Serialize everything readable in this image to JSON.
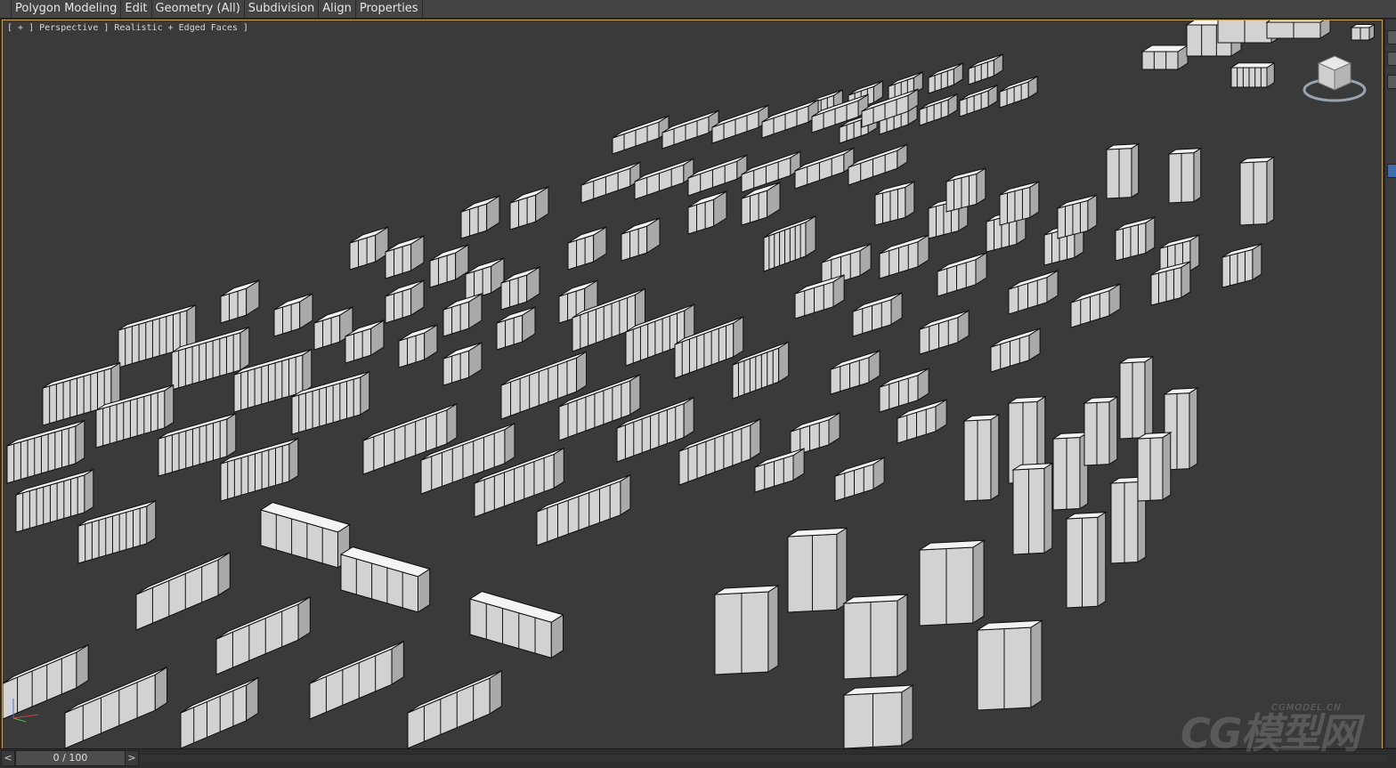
{
  "ribbon": {
    "tabs": [
      {
        "label": "Polygon Modeling"
      },
      {
        "label": "Edit"
      },
      {
        "label": "Geometry (All)"
      },
      {
        "label": "Subdivision"
      },
      {
        "label": "Align"
      },
      {
        "label": "Properties"
      }
    ]
  },
  "viewport": {
    "label": "[ + ] Perspective ] Realistic + Edged Faces ]"
  },
  "timeline": {
    "prev_label": "<",
    "next_label": ">",
    "frame_label": "0 / 100"
  },
  "watermark": {
    "brand": "CG模型网",
    "domain": "CGMODEL.CN"
  },
  "colors": {
    "viewport_bg": "#3a3a3a",
    "viewport_border": "#c9a25a",
    "box_top": "#f4f4f4",
    "box_front": "#d2d2d2",
    "box_side": "#a9a9a9",
    "edge": "#101010"
  }
}
